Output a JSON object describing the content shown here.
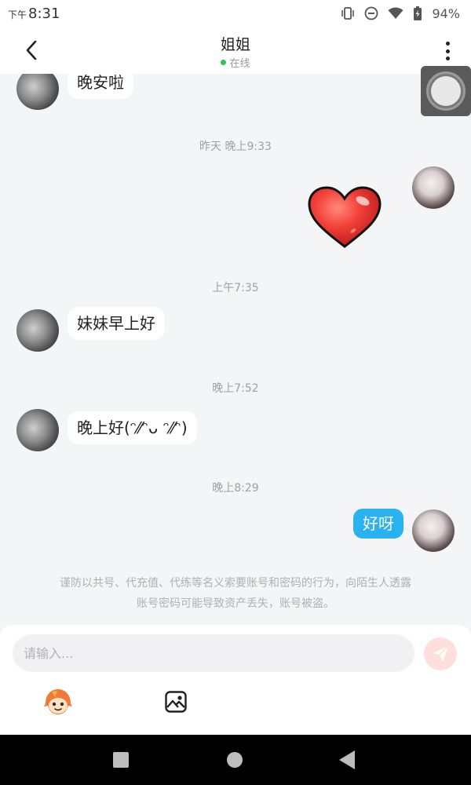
{
  "status_bar": {
    "ampm": "下午",
    "time": "8:31",
    "battery": "94%"
  },
  "header": {
    "title": "姐姐",
    "online_status": "在线"
  },
  "messages": [
    {
      "side": "other",
      "text": "晚安啦"
    },
    {
      "timestamp": "昨天 晚上9:33"
    },
    {
      "side": "me",
      "sticker": "heart-sticker"
    },
    {
      "timestamp": "上午7:35"
    },
    {
      "side": "other",
      "text": "妹妹早上好"
    },
    {
      "timestamp": "晚上7:52"
    },
    {
      "side": "other",
      "text": "晚上好(ᵔ⁄⁄ᵔᴗ ᵔ⁄⁄ᵔ)"
    },
    {
      "timestamp": "晚上8:29"
    },
    {
      "side": "me",
      "text": "好呀"
    }
  ],
  "warning": {
    "line1": "谨防以共号、代充值、代练等名义索要账号和密码的行为，向陌生人透露",
    "line2": "账号密码可能导致资产丢失，账号被盗。"
  },
  "input": {
    "placeholder": "请输入..."
  },
  "colors": {
    "me_bubble": "#2ab1f0",
    "online_dot": "#2fc45a",
    "send_button": "#fde0dd"
  }
}
